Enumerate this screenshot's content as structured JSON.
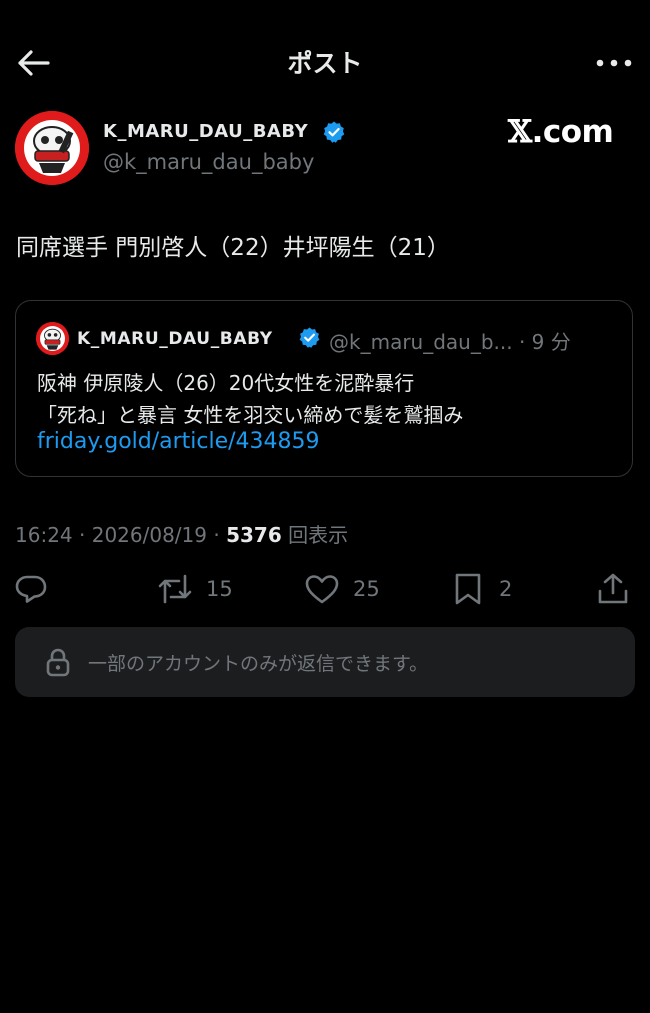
{
  "header": {
    "title": "ポスト"
  },
  "author": {
    "name": "K_MARU_DAU_BABY",
    "handle": "@k_maru_dau_baby"
  },
  "watermark": {
    "x_glyph": "𝕏",
    "suffix": ".com"
  },
  "tweet": {
    "text": "同席選手 門別啓人（22）井坪陽生（21）"
  },
  "quote": {
    "name": "K_MARU_DAU_BABY",
    "handle_time": "@k_maru_dau_b... · 9 分",
    "line1": "阪神 伊原陵人（26）20代女性を泥酔暴行",
    "line2": "「死ね」と暴言 女性を羽交い締めで髪を鷲掴み",
    "link": "friday.gold/article/434859"
  },
  "meta": {
    "time": "16:24",
    "sep1": " · ",
    "date": "2026/08/19",
    "sep2": " · ",
    "views_count": "5376",
    "views_label": " 回表示"
  },
  "actions": {
    "retweets": "15",
    "likes": "25",
    "bookmarks": "2"
  },
  "reply_restriction": {
    "text": "一部のアカウントのみが返信できます。"
  },
  "colors": {
    "background": "#000000",
    "accent": "#1d9bf0",
    "muted": "#71767b",
    "avatar_red": "#e01b1b"
  },
  "icons": [
    "back-arrow-icon",
    "more-icon",
    "verified-badge-icon",
    "reply-icon",
    "retweet-icon",
    "like-icon",
    "bookmark-icon",
    "share-icon",
    "lock-icon"
  ]
}
